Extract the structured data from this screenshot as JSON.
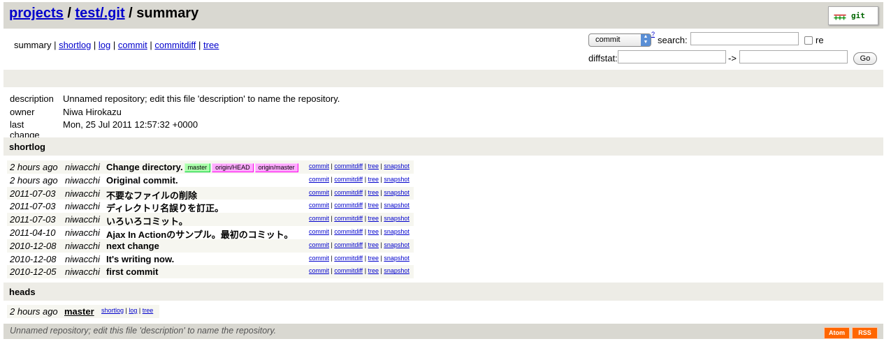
{
  "header": {
    "projects_label": "projects",
    "sep1": " / ",
    "repo_label": "test/.git",
    "sep2": " / ",
    "action": "summary",
    "logo_pm": "−−− +++",
    "logo_word": "git"
  },
  "nav": {
    "current": "summary",
    "links": [
      "shortlog",
      "log",
      "commit",
      "commitdiff",
      "tree"
    ]
  },
  "search": {
    "select_value": "commit",
    "help_mark": "?",
    "search_label": "search:",
    "search_value": "",
    "regex_label": "re",
    "regex_checked": false,
    "diffstat_label": "diffstat:",
    "diffstat_from": "",
    "arrow": "->",
    "diffstat_to": "",
    "go_label": "Go"
  },
  "project_info": {
    "description_key": "description",
    "description": "Unnamed repository; edit this file 'description' to name the repository.",
    "owner_key": "owner",
    "owner": "Niwa Hirokazu",
    "last_change_key": "last change",
    "last_change": "Mon, 25 Jul 2011 12:57:32 +0000"
  },
  "shortlog_title": "shortlog",
  "commit_links": [
    "commit",
    "commitdiff",
    "tree",
    "snapshot"
  ],
  "shortlog": [
    {
      "age": "2 hours ago",
      "author": "niwacchi",
      "subject": "Change directory.",
      "refs": [
        {
          "name": "master",
          "kind": "head"
        },
        {
          "name": "origin/HEAD",
          "kind": "remote"
        },
        {
          "name": "origin/master",
          "kind": "remote"
        }
      ]
    },
    {
      "age": "2 hours ago",
      "author": "niwacchi",
      "subject": "Original commit.",
      "refs": []
    },
    {
      "age": "2011-07-03",
      "author": "niwacchi",
      "subject": "不要なファイルの削除",
      "refs": []
    },
    {
      "age": "2011-07-03",
      "author": "niwacchi",
      "subject": "ディレクトリ名誤りを訂正。",
      "refs": []
    },
    {
      "age": "2011-07-03",
      "author": "niwacchi",
      "subject": "いろいろコミット。",
      "refs": []
    },
    {
      "age": "2011-04-10",
      "author": "niwacchi",
      "subject": "Ajax In Actionのサンプル。最初のコミット。",
      "refs": []
    },
    {
      "age": "2010-12-08",
      "author": "niwacchi",
      "subject": "next change",
      "refs": []
    },
    {
      "age": "2010-12-08",
      "author": "niwacchi",
      "subject": "It's writing now.",
      "refs": []
    },
    {
      "age": "2010-12-05",
      "author": "niwacchi",
      "subject": "first commit",
      "refs": []
    }
  ],
  "heads_title": "heads",
  "head_links": [
    "shortlog",
    "log",
    "tree"
  ],
  "heads": [
    {
      "age": "2 hours ago",
      "name": "master"
    }
  ],
  "footer": {
    "description": "Unnamed repository; edit this file 'description' to name the repository.",
    "atom_label": "Atom",
    "rss_label": "RSS"
  }
}
